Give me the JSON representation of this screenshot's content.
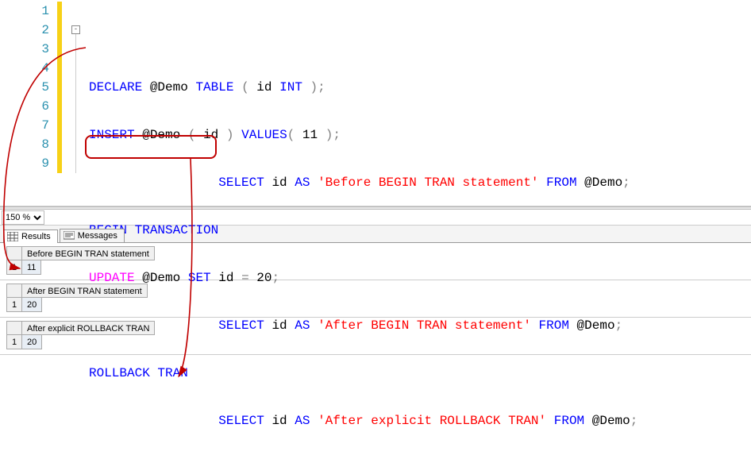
{
  "editor": {
    "line_numbers": [
      "1",
      "2",
      "3",
      "4",
      "5",
      "6",
      "7",
      "8",
      "9"
    ],
    "collapse_glyph": "-",
    "code": {
      "l2": {
        "declare": "DECLARE",
        "var": "@Demo",
        "table": "TABLE",
        "open": "(",
        "id": "id",
        "int": "INT",
        "close": ")",
        "semi": ";"
      },
      "l3": {
        "insert": "INSERT",
        "var": "@Demo",
        "open": "(",
        "id": "id",
        "close": ")",
        "values": "VALUES",
        "op2": "(",
        "num": "11",
        "cl2": ")",
        "semi": ";"
      },
      "l4": {
        "select": "SELECT",
        "id": "id",
        "as": "AS",
        "str": "'Before BEGIN TRAN statement'",
        "from": "FROM",
        "var": "@Demo",
        "semi": ";"
      },
      "l5": {
        "begin": "BEGIN",
        "tran": "TRANSACTION"
      },
      "l6": {
        "update": "UPDATE",
        "var": "@Demo",
        "set": "SET",
        "id": "id",
        "eq": "=",
        "num": "20",
        "semi": ";"
      },
      "l7": {
        "select": "SELECT",
        "id": "id",
        "as": "AS",
        "str": "'After BEGIN TRAN statement'",
        "from": "FROM",
        "var": "@Demo",
        "semi": ";"
      },
      "l8": {
        "rollback": "ROLLBACK",
        "tran": "TRAN"
      },
      "l9": {
        "select": "SELECT",
        "id": "id",
        "as": "AS",
        "str": "'After explicit ROLLBACK TRAN'",
        "from": "FROM",
        "var": "@Demo",
        "semi": ";"
      }
    }
  },
  "zoom": {
    "value": "150 %"
  },
  "tabs": {
    "results": "Results",
    "messages": "Messages"
  },
  "results": {
    "set1": {
      "header": "Before BEGIN TRAN statement",
      "rownum": "1",
      "value": "11"
    },
    "set2": {
      "header": "After BEGIN TRAN statement",
      "rownum": "1",
      "value": "20"
    },
    "set3": {
      "header": "After explicit ROLLBACK TRAN",
      "rownum": "1",
      "value": "20"
    }
  }
}
